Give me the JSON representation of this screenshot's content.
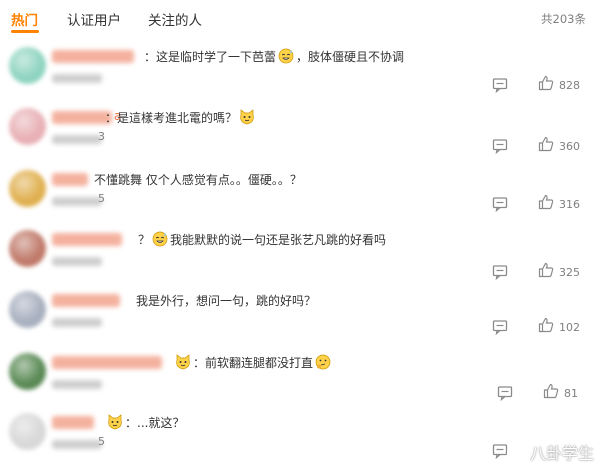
{
  "tabs": [
    {
      "label": "热门",
      "active": true
    },
    {
      "label": "认证用户",
      "active": false
    },
    {
      "label": "关注的人",
      "active": false
    }
  ],
  "total_count": "共203条",
  "accent_color": "#ff8200",
  "comments": [
    {
      "nick_tail": "",
      "time_tail": "",
      "text_before": "：这是临时学了一下芭蕾",
      "emoji": "sweat-smile",
      "text_after": "，肢体僵硬且不协调",
      "likes": "828",
      "avatar_color": "#8fd4c0"
    },
    {
      "nick_tail": "a",
      "time_tail": "3",
      "text_before": "：是這樣考進北電的嗎？",
      "emoji": "cat-face",
      "text_after": "",
      "likes": "360",
      "avatar_color": "#e8b0b5"
    },
    {
      "nick_tail": "",
      "time_tail": "5",
      "text_before": "不懂跳舞 仅个人感觉有点。。僵硬。。？",
      "emoji": "",
      "text_after": "",
      "likes": "316",
      "avatar_color": "#e0b050"
    },
    {
      "nick_tail": "",
      "time_tail": "",
      "text_before": "？",
      "emoji": "sweat-smile",
      "text_after": "我能默默的说一句还是张艺凡跳的好看吗",
      "likes": "325",
      "avatar_color": "#c07a6a"
    },
    {
      "nick_tail": "",
      "time_tail": "",
      "text_before": "我是外行，想问一句，跳的好吗？",
      "emoji": "",
      "text_after": "",
      "likes": "102",
      "avatar_color": "#a8b0bf"
    },
    {
      "nick_tail": "",
      "time_tail": "",
      "text_before": "",
      "emoji": "cat-face",
      "text_after": "：前软翻连腿都没打直",
      "emoji2": "thinking",
      "likes": "81",
      "avatar_color": "#5a8a55"
    },
    {
      "nick_tail": "",
      "time_tail": "5",
      "text_before": "",
      "emoji": "cat-face",
      "text_after": "：...就这？",
      "likes": "",
      "avatar_color": "#d8d8d8"
    }
  ],
  "watermark": "八卦学生",
  "icons": {
    "reply": "comment-icon",
    "like": "thumbs-up-icon"
  }
}
